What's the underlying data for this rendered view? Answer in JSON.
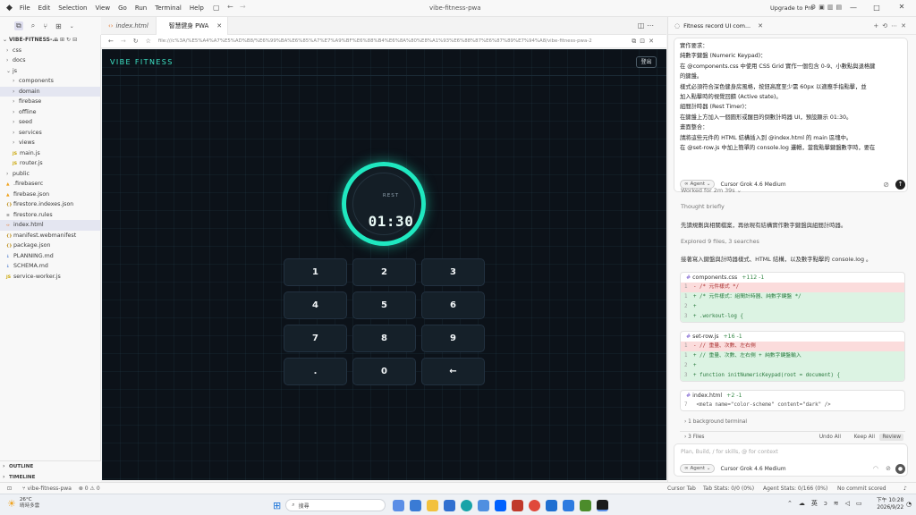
{
  "titlebar": {
    "menu": [
      "File",
      "Edit",
      "Selection",
      "View",
      "Go",
      "Run",
      "Terminal",
      "Help"
    ],
    "search": "vibe-fitness-pwa",
    "upgrade": "Upgrade to Pro"
  },
  "explorer": {
    "root": "VIBE-FITNESS-...",
    "items": [
      {
        "label": "css",
        "type": "folder",
        "depth": 1,
        "open": false
      },
      {
        "label": "docs",
        "type": "folder",
        "depth": 1,
        "open": false
      },
      {
        "label": "js",
        "type": "folder",
        "depth": 1,
        "open": true
      },
      {
        "label": "components",
        "type": "folder",
        "depth": 2,
        "open": false
      },
      {
        "label": "domain",
        "type": "folder",
        "depth": 2,
        "open": false,
        "selected": true
      },
      {
        "label": "firebase",
        "type": "folder",
        "depth": 2,
        "open": false
      },
      {
        "label": "offline",
        "type": "folder",
        "depth": 2,
        "open": false
      },
      {
        "label": "seed",
        "type": "folder",
        "depth": 2,
        "open": false
      },
      {
        "label": "services",
        "type": "folder",
        "depth": 2,
        "open": false
      },
      {
        "label": "views",
        "type": "folder",
        "depth": 2,
        "open": false
      },
      {
        "label": "main.js",
        "type": "js",
        "depth": 2
      },
      {
        "label": "router.js",
        "type": "js",
        "depth": 2
      },
      {
        "label": "public",
        "type": "folder",
        "depth": 1,
        "open": false
      },
      {
        "label": ".firebaserc",
        "type": "fb",
        "depth": 1
      },
      {
        "label": "firebase.json",
        "type": "fb",
        "depth": 1
      },
      {
        "label": "firestore.indexes.json",
        "type": "json",
        "depth": 1
      },
      {
        "label": "firestore.rules",
        "type": "rules",
        "depth": 1
      },
      {
        "label": "index.html",
        "type": "html",
        "depth": 1,
        "selected": true
      },
      {
        "label": "manifest.webmanifest",
        "type": "json",
        "depth": 1
      },
      {
        "label": "package.json",
        "type": "json",
        "depth": 1
      },
      {
        "label": "PLANNING.md",
        "type": "md",
        "depth": 1
      },
      {
        "label": "SCHEMA.md",
        "type": "md",
        "depth": 1
      },
      {
        "label": "service-worker.js",
        "type": "js",
        "depth": 1
      }
    ],
    "outline": "OUTLINE",
    "timeline": "TIMELINE"
  },
  "editor": {
    "tabs": [
      {
        "label": "index.html",
        "active": false
      },
      {
        "label": "智慧健身 PWA",
        "active": true
      }
    ],
    "url": "file:///c%3A/%E5%A4%A7%E5%AD%B8/%E6%99%BA%E6%85%A7%E7%A9%BF%E6%88%B4%E6%8A%80%E8%A1%93%E6%88%87%E6%87%89%E7%94%A8/vibe-fitness-pwa-2"
  },
  "app": {
    "brand": "VIBE FITNESS",
    "logout": "登出",
    "timer": {
      "label": "REST",
      "value": "01:30",
      "accent": "#1fe8c0"
    },
    "keys": [
      "1",
      "2",
      "3",
      "4",
      "5",
      "6",
      "7",
      "8",
      "9",
      ".",
      "0",
      "←"
    ]
  },
  "chat": {
    "tab_title": "Fitness record UI com...",
    "prompt_lines": [
      "實作要求：",
      "純數字鍵盤 (Numeric Keypad)：",
      "在 @components.css 中使用 CSS Grid 實作一個包含 0-9、小數點與退格鍵",
      "的鍵盤。",
      "樣式必須符合深色健身房風格，按鈕高度至少需 60px 以適應手指點擊，並",
      "加入點擊時的視覺回饋 (Active state)。",
      "組間計時器 (Rest Timer)：",
      "在鍵盤上方加入一個圓形或醒目的倒數計時器 UI，預設顯示 01:30。",
      "畫面整合：",
      "請將這些元件的 HTML 結構插入到 @index.html 的 main 區塊中。",
      "在 @set-row.js 中加上簡單的 console.log 邏輯，當我點擊鍵盤數字時，要在"
    ],
    "agent": "Agent",
    "model": "Cursor Grok 4.6 Medium",
    "worked": "Worked for 2m 39s",
    "thought": "Thought briefly",
    "msg1": "先讀規劃與相關檔案，再依現有結構實作數字鍵盤與組間計時器。",
    "explored": "Explored 9 files, 3 searches",
    "msg2": "接著寫入鍵盤與計時器樣式、HTML 結構，以及數字點擊的 console.log 。",
    "diffs": [
      {
        "file": "components.css",
        "stat": "+112 -1",
        "lines": [
          {
            "t": "del",
            "n": "1",
            "c": "- /* 元件樣式 */"
          },
          {
            "t": "add",
            "n": "1",
            "c": "+ /* 元件樣式：組間計時器、純數字鍵盤 */"
          },
          {
            "t": "add",
            "n": "2",
            "c": "+"
          },
          {
            "t": "add",
            "n": "3",
            "c": "+ .workout-log {"
          }
        ]
      },
      {
        "file": "set-row.js",
        "stat": "+16 -1",
        "lines": [
          {
            "t": "del",
            "n": "1",
            "c": "- // 重量、次數、左右側"
          },
          {
            "t": "add",
            "n": "1",
            "c": "+ // 重量、次數、左右側 + 純數字鍵盤輸入"
          },
          {
            "t": "add",
            "n": "2",
            "c": "+"
          },
          {
            "t": "add",
            "n": "3",
            "c": "+ function initNumericKeypad(root = document) {"
          }
        ]
      },
      {
        "file": "index.html",
        "stat": "+2 -1",
        "lines": [
          {
            "t": "ctx",
            "n": "7",
            "c": "    <meta name=\"color-scheme\" content=\"dark\" />"
          }
        ]
      }
    ],
    "bg_terminal": "1 background terminal",
    "files": "3 Files",
    "undo": "Undo All",
    "keep": "Keep All",
    "review": "Review",
    "input_placeholder": "Plan, Build, / for skills, @ for context"
  },
  "statusbar": {
    "branch": "vibe-fitness-pwa",
    "problems": "⊗ 0 ⚠ 0",
    "cursor_tab": "Cursor Tab",
    "tab_stats": "Tab Stats: 0/0 (0%)",
    "agent_stats": "Agent Stats: 0/166 (0%)",
    "commit": "No commit scored"
  },
  "taskbar": {
    "weather_temp": "26°C",
    "weather_desc": "晴時多雲",
    "search": "搜尋",
    "lang": "英",
    "time": "下午 10:28",
    "date": "2026/9/22"
  }
}
